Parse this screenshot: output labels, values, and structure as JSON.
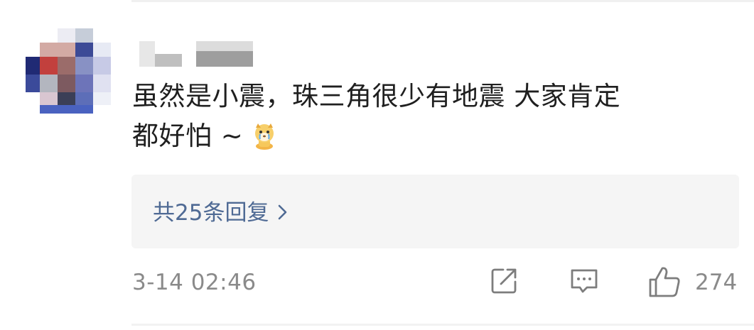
{
  "comment": {
    "line1": "虽然是小震，珠三角很少有地震 大家肯定",
    "line2": "都好怕 ~",
    "emoji": "crying-dog-emoji"
  },
  "replies": {
    "label": "共25条回复"
  },
  "meta": {
    "timestamp": "3-14 02:46",
    "like_count": "274"
  },
  "icons": {
    "share": "share-icon",
    "reply": "comment-icon",
    "like": "thumbs-up-icon",
    "chevron": "chevron-right-icon"
  },
  "colors": {
    "link": "#4f6a94",
    "meta": "#8a8a8a",
    "reply_bg": "#f5f5f5",
    "text": "#1f1f1f"
  }
}
